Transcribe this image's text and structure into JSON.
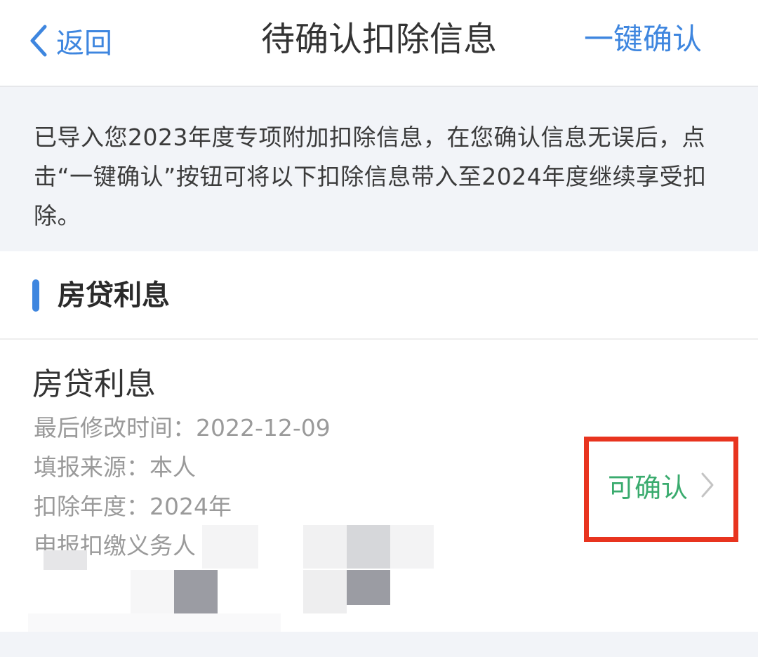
{
  "nav": {
    "back_label": "返回",
    "title": "待确认扣除信息",
    "confirm_all_label": "一键确认"
  },
  "notice": {
    "text": "已导入您2023年度专项附加扣除信息，在您确认信息无误后，点击“一键确认”按钮可将以下扣除信息带入至2024年度继续享受扣除。"
  },
  "section": {
    "title": "房贷利息"
  },
  "item": {
    "title": "房贷利息",
    "modified": "最后修改时间：2022-12-09",
    "source": "填报来源：本人",
    "year": "扣除年度：2024年",
    "obligor_partial": "申报扣缴义务人",
    "status_label": "可确认"
  },
  "colors": {
    "accent": "#3e86df",
    "status_green": "#3aab6e",
    "highlight_red": "#e8341f",
    "notice_bg": "#f2f4f8"
  },
  "icons": {
    "back": "chevron-left-icon",
    "status_arrow": "chevron-right-icon"
  }
}
